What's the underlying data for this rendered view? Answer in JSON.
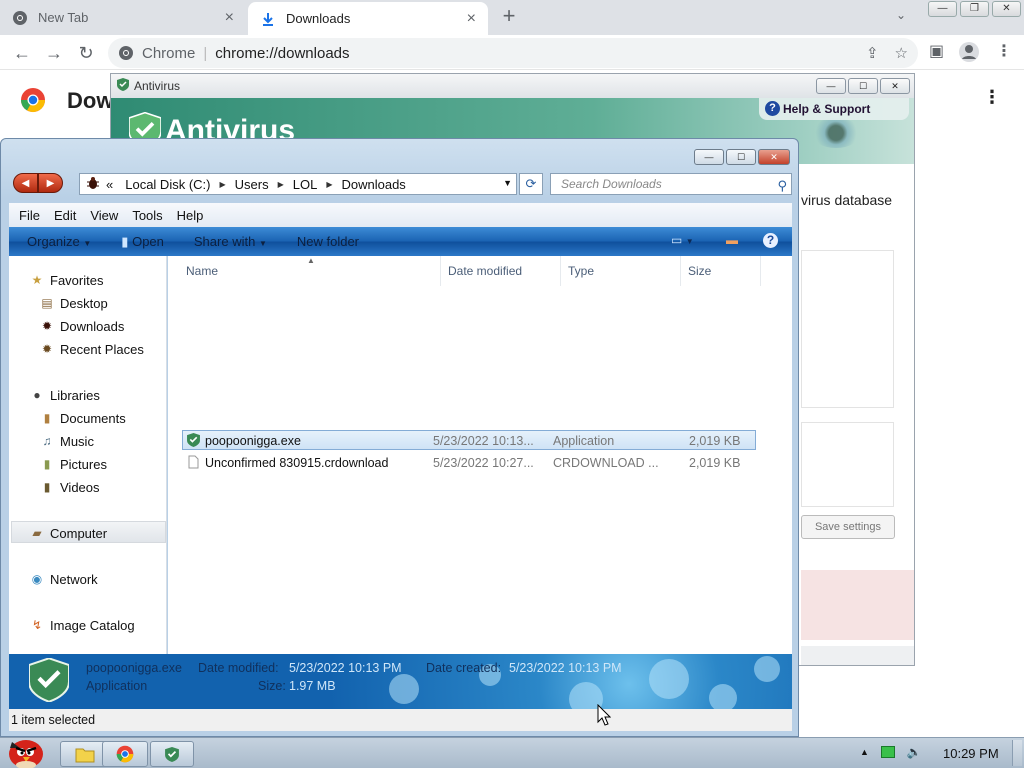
{
  "chrome": {
    "tabs": [
      {
        "label": "New Tab",
        "close": "×"
      },
      {
        "label": "Downloads",
        "close": "×"
      }
    ],
    "new_tab": "+",
    "omnibox": {
      "site": "Chrome",
      "url": "chrome://downloads"
    },
    "page_title": "Dow"
  },
  "antivirus": {
    "title": "Antivirus",
    "banner_title": "Antivirus",
    "help": "Help & Support",
    "text_fragment": "virus database",
    "save_settings": "Save settings"
  },
  "explorer": {
    "breadcrumb": [
      "Local Disk (C:)",
      "Users",
      "LOL",
      "Downloads"
    ],
    "breadcrumb_prefix": "«",
    "search_placeholder": "Search Downloads",
    "menu": [
      "File",
      "Edit",
      "View",
      "Tools",
      "Help"
    ],
    "commands": {
      "organize": "Organize",
      "open": "Open",
      "share": "Share with",
      "new_folder": "New folder"
    },
    "nav": {
      "favorites": "Favorites",
      "desktop": "Desktop",
      "downloads": "Downloads",
      "recent": "Recent Places",
      "libraries": "Libraries",
      "documents": "Documents",
      "music": "Music",
      "pictures": "Pictures",
      "videos": "Videos",
      "computer": "Computer",
      "network": "Network",
      "image_catalog": "Image Catalog"
    },
    "columns": {
      "name": "Name",
      "date": "Date modified",
      "type": "Type",
      "size": "Size"
    },
    "files": [
      {
        "name": "poopoonigga.exe",
        "date": "5/23/2022 10:13...",
        "type": "Application",
        "size": "2,019 KB"
      },
      {
        "name": "Unconfirmed 830915.crdownload",
        "date": "5/23/2022 10:27...",
        "type": "CRDOWNLOAD ...",
        "size": "2,019 KB"
      }
    ],
    "details": {
      "name": "poopoonigga.exe",
      "kind": "Application",
      "modified_label": "Date modified:",
      "modified": "5/23/2022 10:13 PM",
      "created_label": "Date created:",
      "created": "5/23/2022 10:13 PM",
      "size_label": "Size:",
      "size": "1.97 MB"
    },
    "status": "1 item selected"
  },
  "taskbar": {
    "clock": "10:29 PM"
  },
  "colors": {
    "chrome_bg": "#dee1e6",
    "av_green": "#2f8b73",
    "cmdbar_blue": "#1a62b2",
    "taskbar": "#b8c8d8"
  }
}
